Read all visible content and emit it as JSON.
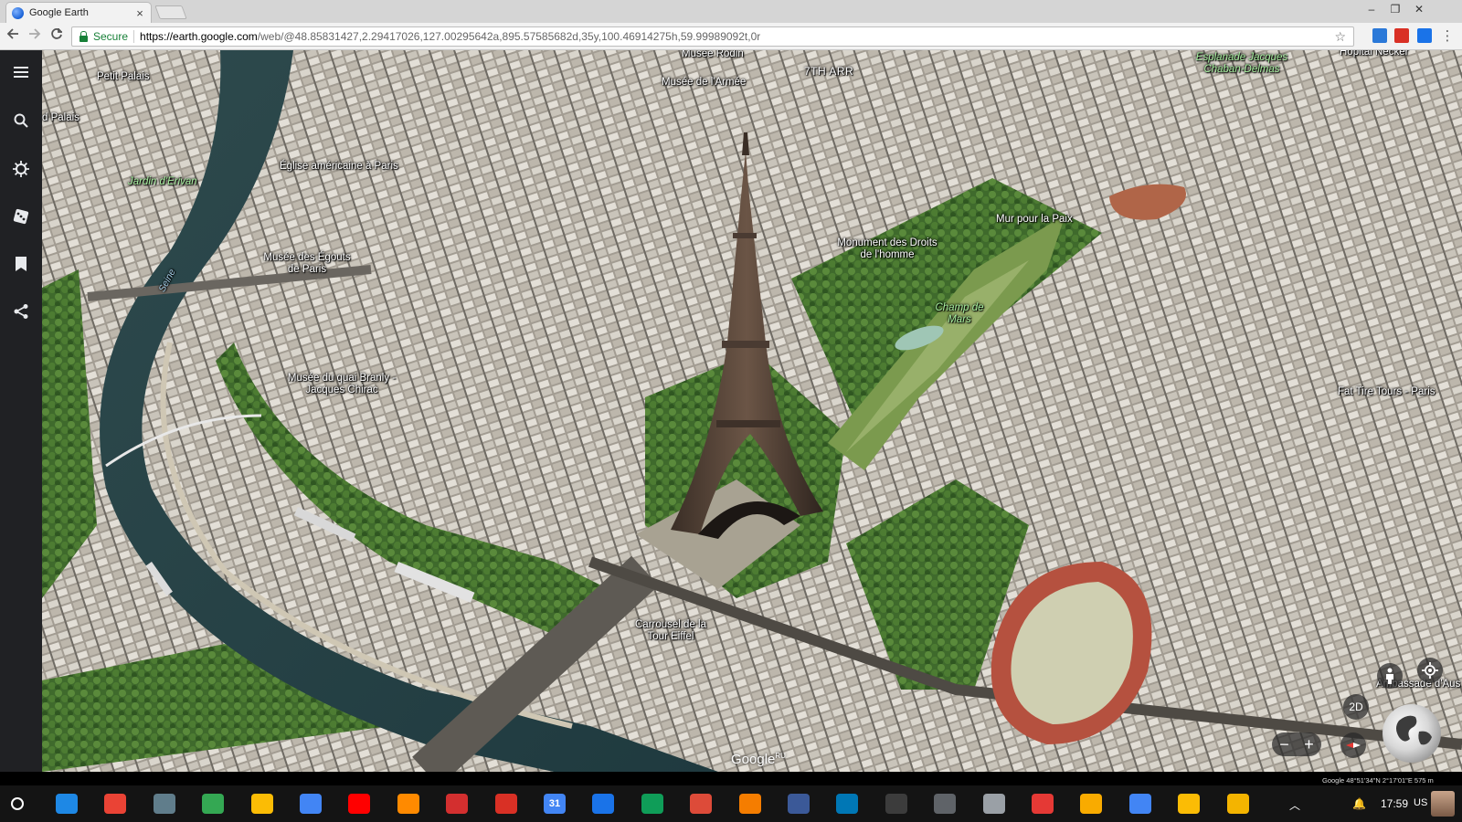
{
  "browser": {
    "tab_title": "Google Earth",
    "tab_close": "×",
    "window_controls": [
      "–",
      "❐",
      "✕"
    ],
    "secure_label": "Secure",
    "url_host": "https://earth.google.com",
    "url_path": "/web/@48.85831427,2.29417026,127.00295642a,895.57585682d,35y,100.46914275h,59.99989092t,0r"
  },
  "rail": {
    "items": [
      {
        "icon": "menu-icon"
      },
      {
        "icon": "search-icon"
      },
      {
        "icon": "voyager-icon"
      },
      {
        "icon": "feeling-lucky-icon"
      },
      {
        "icon": "projects-icon"
      },
      {
        "icon": "share-icon"
      }
    ]
  },
  "map": {
    "labels": [
      {
        "text": "Musée Rodin",
        "style": "plain"
      },
      {
        "text": "7TH ARR",
        "style": "arr"
      },
      {
        "text": "Musée de l'Armée",
        "style": "plain"
      },
      {
        "text": "Petit Palais",
        "style": "plain"
      },
      {
        "text": "d Palais",
        "style": "plain"
      },
      {
        "text": "Esplanade Jacques Chaban-Delmas",
        "style": "green"
      },
      {
        "text": "Hôpital Necker",
        "style": "plain"
      },
      {
        "text": "Église américaine à Paris",
        "style": "plain"
      },
      {
        "text": "Jardin d'Erivan",
        "style": "green"
      },
      {
        "text": "Mur pour la Paix",
        "style": "plain"
      },
      {
        "text": "Monument des Droits de l'homme",
        "style": "plain"
      },
      {
        "text": "Musée des Égouts de Paris",
        "style": "plain"
      },
      {
        "text": "Seine",
        "style": "river"
      },
      {
        "text": "Champ de Mars",
        "style": "green"
      },
      {
        "text": "Musée du quai Branly - Jacques Chirac",
        "style": "plain"
      },
      {
        "text": "Fat Tire Tours - Paris",
        "style": "plain"
      },
      {
        "text": "Carrousel de la Tour Eiffel",
        "style": "plain"
      },
      {
        "text": "Ambassade d'Aus",
        "style": "plain"
      }
    ],
    "watermark": "Google",
    "watermark_sup": "RU",
    "attribution": "Google     48°51'34\"N 2°17'01\"E     575 m",
    "controls": {
      "view_mode": "2D",
      "zoom_out": "−",
      "zoom_in": "+"
    }
  },
  "taskbar": {
    "apps": [
      {
        "icon": "files-icon",
        "color": "#1e88e5"
      },
      {
        "icon": "chrome-icon",
        "color": "#ea4335"
      },
      {
        "icon": "calculator-icon",
        "color": "#607d8b"
      },
      {
        "icon": "drive-icon",
        "color": "#34a853"
      },
      {
        "icon": "keep-icon",
        "color": "#fbbc05"
      },
      {
        "icon": "docs-icon",
        "color": "#4285f4"
      },
      {
        "icon": "youtube-icon",
        "color": "#ff0000"
      },
      {
        "icon": "play-music-icon",
        "color": "#ff8a00"
      },
      {
        "icon": "video-player-icon",
        "color": "#d32f2f"
      },
      {
        "icon": "gmail-icon",
        "color": "#d93025"
      },
      {
        "icon": "calendar-icon",
        "color": "#4285f4"
      },
      {
        "icon": "contacts-icon",
        "color": "#1a73e8"
      },
      {
        "icon": "maps-icon",
        "color": "#0f9d58"
      },
      {
        "icon": "google-plus-icon",
        "color": "#dd4b39"
      },
      {
        "icon": "blogger-icon",
        "color": "#f57d00"
      },
      {
        "icon": "facebook-icon",
        "color": "#3b5998"
      },
      {
        "icon": "linkedin-icon",
        "color": "#0077b5"
      },
      {
        "icon": "code-editor-icon",
        "color": "#3c3c3c"
      },
      {
        "icon": "settings-hex-icon",
        "color": "#5f6368"
      },
      {
        "icon": "slides-viewer-icon",
        "color": "#9aa0a6"
      },
      {
        "icon": "pages-icon",
        "color": "#e53935"
      },
      {
        "icon": "analytics-icon",
        "color": "#f9ab00"
      },
      {
        "icon": "web-store-icon",
        "color": "#4285f4"
      },
      {
        "icon": "power-icon",
        "color": "#fbbc05"
      },
      {
        "icon": "chrome-canary-icon",
        "color": "#f4b400"
      }
    ],
    "calendar_day": "31",
    "clock": "17:59",
    "locale": "US"
  }
}
